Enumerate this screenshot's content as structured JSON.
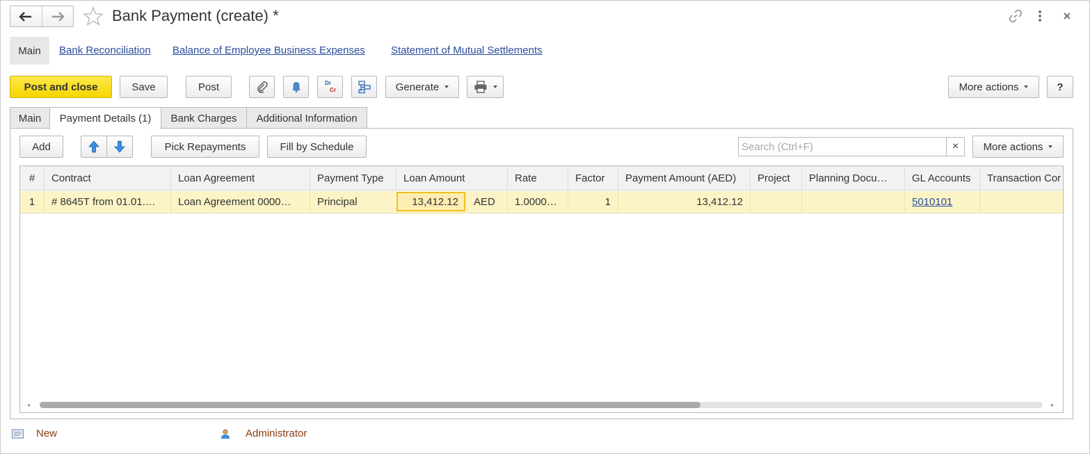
{
  "window": {
    "title": "Bank Payment (create) *"
  },
  "sections": {
    "main": "Main",
    "links": [
      "Bank Reconciliation",
      "Balance of Employee Business Expenses",
      "Statement of Mutual Settlements"
    ]
  },
  "toolbar": {
    "post_and_close": "Post and close",
    "save": "Save",
    "post": "Post",
    "dr": "Dr",
    "cr": "Cr",
    "generate": "Generate",
    "more_actions": "More actions",
    "help": "?"
  },
  "tabs": [
    "Main",
    "Payment Details (1)",
    "Bank Charges",
    "Additional Information"
  ],
  "details_toolbar": {
    "add": "Add",
    "pick_repayments": "Pick Repayments",
    "fill_by_schedule": "Fill by Schedule",
    "search_placeholder": "Search (Ctrl+F)",
    "clear": "×",
    "more_actions": "More actions"
  },
  "table": {
    "columns": [
      "#",
      "Contract",
      "Loan Agreement",
      "Payment Type",
      "Loan Amount",
      "Rate",
      "Factor",
      "Payment Amount (AED)",
      "Project",
      "Planning Docu…",
      "GL Accounts",
      "Transaction Cor"
    ],
    "rows": [
      {
        "num": "1",
        "contract": "# 8645T from 01.01.…",
        "loan_agreement": "Loan Agreement 0000…",
        "payment_type": "Principal",
        "loan_amount": "13,412.12",
        "currency": "AED",
        "rate": "1.0000…",
        "factor": "1",
        "payment_amount": "13,412.12",
        "project": "",
        "planning_doc": "",
        "gl_accounts": "5010101",
        "transaction": ""
      }
    ]
  },
  "footer": {
    "status": "New",
    "user": "Administrator"
  },
  "colors": {
    "primary_button": "#f6d500",
    "row_highlight": "#fcf4c6",
    "link": "#2a4c9b",
    "footer_text": "#8a3c10"
  }
}
